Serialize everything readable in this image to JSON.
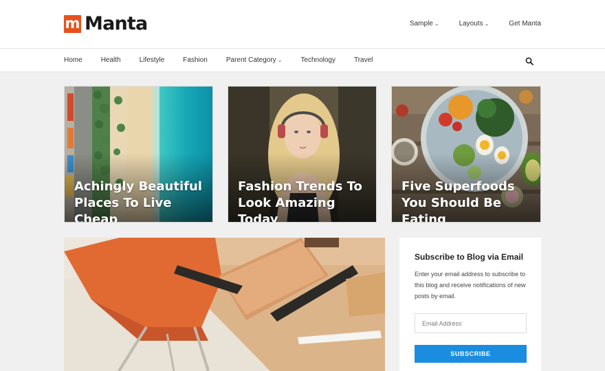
{
  "header": {
    "logo_mark": "m",
    "logo_text": "Manta",
    "top_menu": [
      {
        "label": "Sample",
        "has_dropdown": true
      },
      {
        "label": "Layouts",
        "has_dropdown": true
      },
      {
        "label": "Get Manta",
        "has_dropdown": false
      }
    ]
  },
  "nav": {
    "items": [
      {
        "label": "Home"
      },
      {
        "label": "Health"
      },
      {
        "label": "Lifestyle"
      },
      {
        "label": "Fashion"
      },
      {
        "label": "Parent Category",
        "has_dropdown": true
      },
      {
        "label": "Technology"
      },
      {
        "label": "Travel"
      }
    ],
    "search_icon": "search-icon"
  },
  "featured": [
    {
      "title": "Achingly Beautiful Places To Live Cheap",
      "image": "beach-aerial"
    },
    {
      "title": "Fashion Trends To Look Amazing Today",
      "image": "woman-headphones"
    },
    {
      "title": "Five Superfoods You Should Be Eating",
      "image": "food-bowl"
    }
  ],
  "main_post": {
    "image": "desk-orange-chair"
  },
  "sidebar": {
    "widget_title": "Subscribe to Blog via Email",
    "widget_text": "Enter your email address to subscribe to this blog and receive notifications of new posts by email.",
    "email_placeholder": "Email Address",
    "subscribe_label": "SUBSCRIBE"
  },
  "colors": {
    "brand": "#e8511d",
    "button": "#1b8de0",
    "page_bg": "#f0f0f0"
  }
}
